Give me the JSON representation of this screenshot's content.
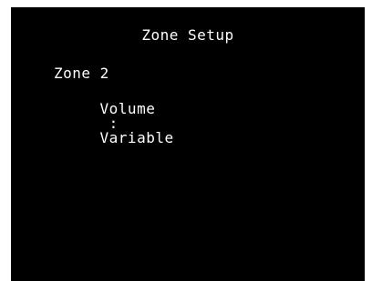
{
  "screen": {
    "title": "Zone Setup",
    "zone_label": "Zone 2",
    "setting": {
      "name": "Volume",
      "separator": ":",
      "value": "Variable"
    }
  },
  "colors": {
    "background": "#000000",
    "text": "#ffffff",
    "border": "#ffffff"
  }
}
